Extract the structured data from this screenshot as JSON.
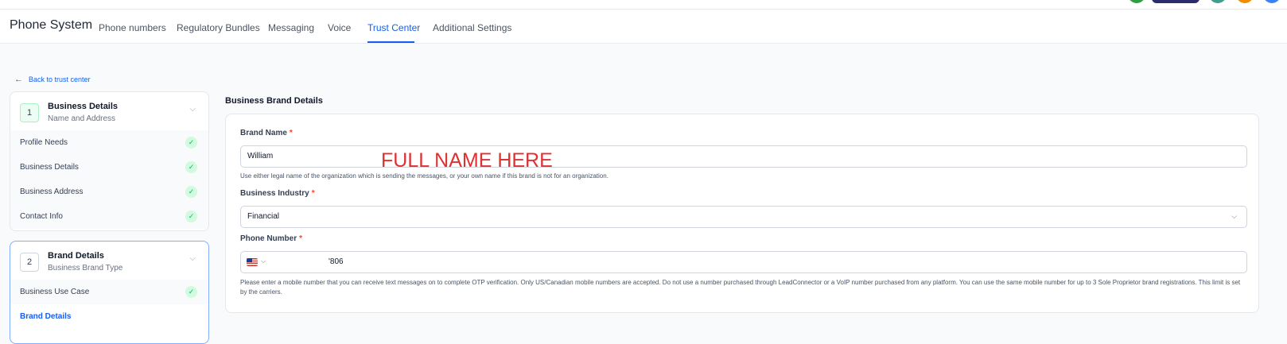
{
  "header": {
    "app_title": "Phone System",
    "tabs": [
      {
        "label": "Phone numbers"
      },
      {
        "label": "Regulatory Bundles"
      },
      {
        "label": "Messaging"
      },
      {
        "label": "Voice"
      },
      {
        "label": "Trust Center"
      },
      {
        "label": "Additional Settings"
      }
    ],
    "active_tab": "Trust Center",
    "avatar_colors": [
      "#2f9e44",
      "#2b2c6e",
      "#3f9e8e",
      "#f08c00",
      "#3b82f6"
    ]
  },
  "sidebar": {
    "back_link": "Back to trust center",
    "steps": [
      {
        "number": "1",
        "title": "Business Details",
        "subtitle": "Name and Address",
        "items": [
          {
            "label": "Profile Needs",
            "completed": true
          },
          {
            "label": "Business Details",
            "completed": true
          },
          {
            "label": "Business Address",
            "completed": true
          },
          {
            "label": "Contact Info",
            "completed": true
          }
        ]
      },
      {
        "number": "2",
        "title": "Brand Details",
        "subtitle": "Business Brand Type",
        "items": [
          {
            "label": "Business Use Case",
            "completed": true
          },
          {
            "label": "Brand Details",
            "completed": false
          }
        ]
      }
    ]
  },
  "main": {
    "section_title": "Business Brand Details",
    "brand_name": {
      "label": "Brand Name",
      "required_mark": "*",
      "value": "William",
      "help": "Use either legal name of the organization which is sending the messages, or your own name if this brand is not for an organization."
    },
    "industry": {
      "label": "Business Industry",
      "required_mark": "*",
      "value": "Financial"
    },
    "phone": {
      "label": "Phone Number",
      "required_mark": "*",
      "value": "'806",
      "help": "Please enter a mobile number that you can receive text messages on to complete OTP verification. Only US/Canadian mobile numbers are accepted. Do not use a number purchased through LeadConnector or a VoIP number purchased from any platform. You can use the same mobile number for up to 3 Sole Proprietor brand registrations. This limit is set by the carriers."
    },
    "overlay_annotation": "FULL NAME HERE"
  },
  "icons": {
    "back": "←",
    "chevron": "⌵",
    "check": "✓"
  },
  "colors": {
    "accent": "#155eef",
    "required": "#f04438",
    "success": "#12b76a",
    "annotation": "#e03131"
  }
}
